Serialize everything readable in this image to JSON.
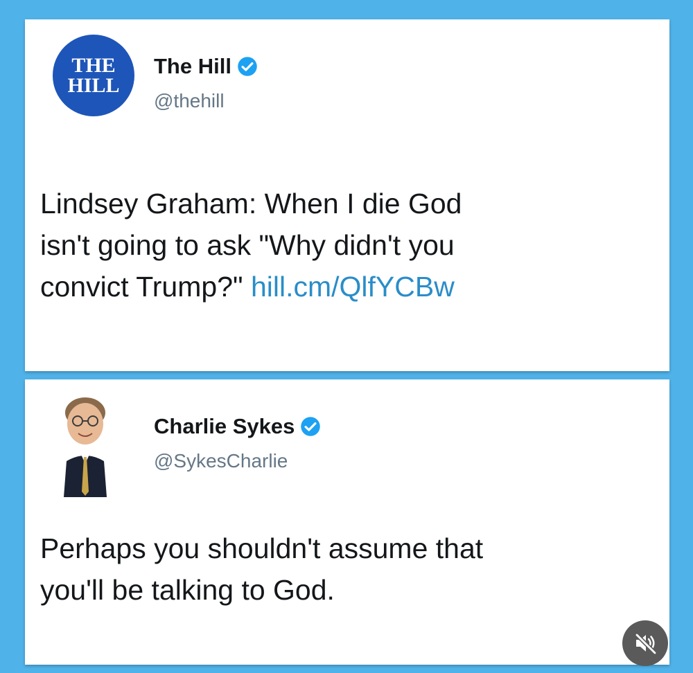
{
  "tweets": [
    {
      "avatar_text_line1": "THE",
      "avatar_text_line2": "HILL",
      "name": "The Hill",
      "handle": "@thehill",
      "verified": true,
      "text_lines": [
        "Lindsey Graham: When I die God",
        "isn't going to ask \"Why didn't you",
        "convict Trump?\""
      ],
      "link": "hill.cm/QlfYCBw"
    },
    {
      "name": "Charlie Sykes",
      "handle": "@SykesCharlie",
      "verified": true,
      "text_lines": [
        "Perhaps you shouldn't assume that",
        "you'll be talking to God."
      ]
    }
  ],
  "colors": {
    "background": "#4fb2e8",
    "hill_blue": "#1e55b8",
    "verified_blue": "#1da1f2",
    "link_blue": "#2a8dc8",
    "handle_gray": "#657786"
  },
  "icons": {
    "verified": "verified-badge-icon",
    "mute": "speaker-muted-icon"
  }
}
